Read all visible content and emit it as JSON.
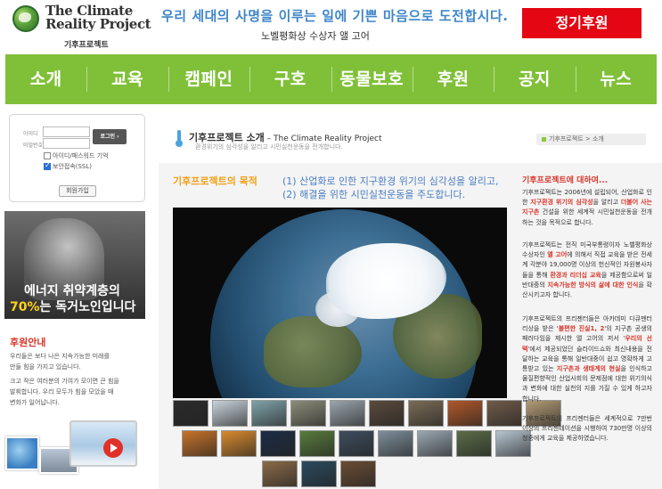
{
  "header": {
    "logo_title_line1": "The Climate",
    "logo_title_line2": "Reality Project",
    "logo_subtitle": "기후프로젝트",
    "slogan": "우리 세대의 사명을 이루는 일에 기쁜 마음으로 도전합시다.",
    "slogan_attribution": "노벨평화상 수상자 앨 고어",
    "donate_label": "정기후원"
  },
  "nav": {
    "items": [
      "소개",
      "교육",
      "캠페인",
      "구호",
      "동물보호",
      "후원",
      "공지",
      "뉴스"
    ]
  },
  "login": {
    "id_label": "아이디",
    "password_label": "비밀번호",
    "login_button": "로그인",
    "remember_label": "아이디/패스워드 기억",
    "ssl_label": "보안접속(SSL)",
    "join_button": "회원가입"
  },
  "promo": {
    "line1": "에너지 취약계층의",
    "line2_highlight": "70%",
    "line2_rest": "는 독거노인입니다"
  },
  "support": {
    "title": "후원안내",
    "para1_line1": "우리들은 보다 나은 지속가능한 미래를",
    "para1_line2": "만들 힘을 가지고 있습니다.",
    "para2_line1": "크고 작은 여러분의 기여가 모이면 큰 힘을",
    "para2_line2": "발휘합니다. 우리 모두가 힘을 모았을 때",
    "para2_line3": "변화가 일어납니다."
  },
  "page": {
    "title": "기후프로젝트 소개",
    "title_en": " – The Climate Reality Project",
    "description": "환경위기의 심각성을 알리고 시민실천운동을 전개합니다.",
    "breadcrumb": "기후프로젝트 > 소개"
  },
  "purpose": {
    "title": "기후프로젝트의 목적",
    "item1": "(1) 산업화로 인한 지구환경 위기의 심각성을 알리고,",
    "item2": "(2) 해결을 위한 시민실천운동을 주도합니다."
  },
  "thumbnail_colors": [
    [
      "#2b2b2b",
      "#c9d3dc",
      "#7fa3a9",
      "#8c8c7a",
      "#9aa5ad",
      "#5a4a3c",
      "#7a6b55",
      "#b0582a",
      "#6f5b49",
      "#b39a74"
    ],
    [
      "#c8732a",
      "#d98a2e",
      "#1c2d45",
      "#587b3c",
      "#3d4d5e",
      "#7d8e9a",
      "#9aa7b2",
      "#5a6d48",
      "#b6c5d0"
    ],
    [
      "#8a6a48",
      "#2b4a5e",
      "#6a4c34"
    ]
  ],
  "about": {
    "title": "기후프로젝트에 대하여...",
    "p1_a": "기후프로젝트는 2006년에 설립되어, 산업화로 인한 ",
    "p1_hl1": "지구환경 위기의 심각성",
    "p1_b": "을 알리고 ",
    "p1_hl2": "더불어 사는 지구촌",
    "p1_c": " 건설을 위한 세계적 시민실천운동을 전개하는 것을 목적으로 합니다.",
    "p2_a": "기후프로젝트는 전직 미국부통령이자 노벨평화상 수상자인 ",
    "p2_hl1": "앨 고어",
    "p2_b": "에 의해서 직접 교육을 받은 전세계 각분야 19,000명 이상의 헌신적인 자원봉사자들을 통해 ",
    "p2_hl2": "환경과 리더십 교육",
    "p2_c": "을 제공함으로써 일반대중의 ",
    "p2_hl3": "지속가능한 방식의 삶에 대한 인식",
    "p2_d": "을 확산시키고자 합니다.",
    "p3_a": "기후프로젝트의 프리젠터들은 아카데미 다큐멘터리상을 받은 '",
    "p3_hl1": "불편한 진실1, 2",
    "p3_b": "'의 지구촌 공생의 패러다임을 제시한 앨 고어의 저서 '",
    "p3_hl2": "우리의 선택",
    "p3_c": "'에서 제공되었던 슬라이드쇼와 최신내용을 전달하는 교육을 통해 일반대중이 쉽고 명확하게 고통받고 있는 ",
    "p3_hl3": "지구촌과 생태계의 현실",
    "p3_d": "을 인식하고 물질편향적인 산업사회의 문제점에 대한 위기의식과 변화에 대한 실천의 지를 가질 수 있게 하고자 합니다.",
    "p4": "기후프로젝트의 프리젠터들은 세계적으로 7만번 이상의 프리젠테이션을 시행하여 730만명 이상의 청중에게 교육을 제공하였습니다."
  }
}
